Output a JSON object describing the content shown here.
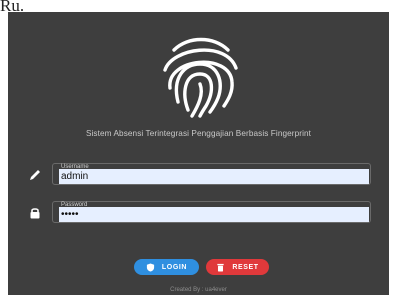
{
  "header_fragment": "Ru.",
  "app": {
    "subtitle": "Sistem Absensi Terintegrasi Penggajian Berbasis Fingerprint",
    "logo_icon": "fingerprint-icon"
  },
  "form": {
    "username": {
      "label": "Username",
      "value": "admin",
      "icon": "pencil-icon"
    },
    "password": {
      "label": "Password",
      "value": "•••••",
      "icon": "lock-icon"
    }
  },
  "buttons": {
    "login": {
      "label": "LOGIN",
      "icon": "shield-icon",
      "color": "#2f8fe0"
    },
    "reset": {
      "label": "RESET",
      "icon": "trash-icon",
      "color": "#e0393b"
    }
  },
  "footer": {
    "credit": "Created By : ua4ever"
  },
  "colors": {
    "panel_bg": "#3e3e3e",
    "input_bg": "#e6efff"
  }
}
